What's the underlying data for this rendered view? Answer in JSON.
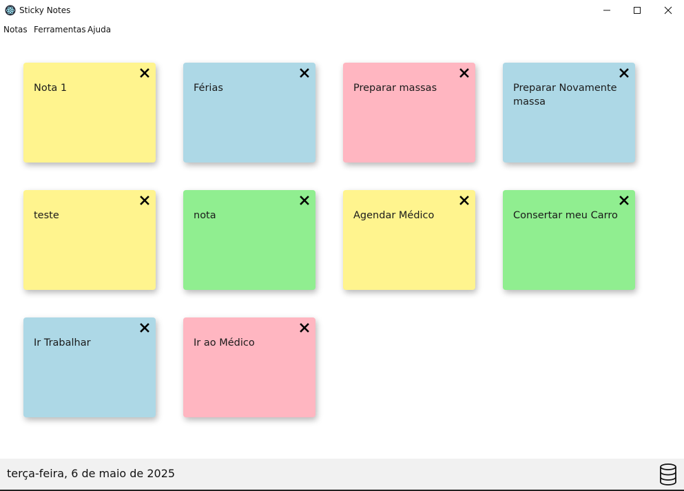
{
  "window": {
    "title": "Sticky Notes",
    "app_icon": "electron-icon",
    "controls": [
      "minimize-icon",
      "maximize-icon",
      "close-icon"
    ]
  },
  "menu": {
    "items": [
      "Notas",
      "Ferramentas",
      "Ajuda"
    ]
  },
  "colors": {
    "yellow": "#fff48e",
    "blue": "#add8e6",
    "pink": "#ffb6c1",
    "green": "#90ee90",
    "statusbar": "#f1f1f1"
  },
  "notes": [
    {
      "text": "Nota 1",
      "color": "yellow"
    },
    {
      "text": "Férias",
      "color": "blue"
    },
    {
      "text": "Preparar massas",
      "color": "pink"
    },
    {
      "text": "Preparar Novamente massa",
      "color": "blue"
    },
    {
      "text": "teste",
      "color": "yellow"
    },
    {
      "text": "nota",
      "color": "green"
    },
    {
      "text": "Agendar Médico",
      "color": "yellow"
    },
    {
      "text": "Consertar meu Carro",
      "color": "green"
    },
    {
      "text": "Ir Trabalhar",
      "color": "blue"
    },
    {
      "text": "Ir ao Médico",
      "color": "pink"
    }
  ],
  "note_close_icon": "close-x-icon",
  "status": {
    "date": "terça-feira, 6 de maio de 2025",
    "icon": "database-icon"
  }
}
